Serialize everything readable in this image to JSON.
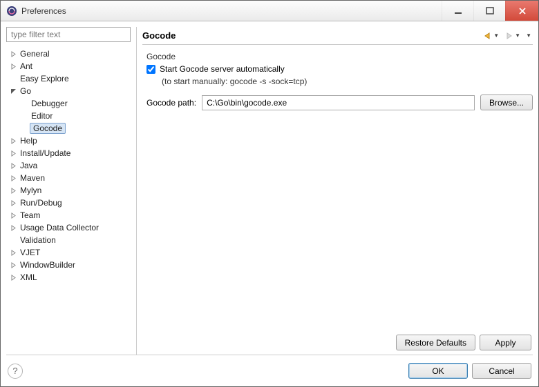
{
  "window": {
    "title": "Preferences"
  },
  "filter": {
    "placeholder": "type filter text"
  },
  "tree": {
    "items": [
      {
        "label": "General",
        "hasTwisty": true,
        "expanded": false
      },
      {
        "label": "Ant",
        "hasTwisty": true,
        "expanded": false
      },
      {
        "label": "Easy Explore",
        "hasTwisty": false
      },
      {
        "label": "Go",
        "hasTwisty": true,
        "expanded": true,
        "children": [
          {
            "label": "Debugger"
          },
          {
            "label": "Editor"
          },
          {
            "label": "Gocode",
            "selected": true
          }
        ]
      },
      {
        "label": "Help",
        "hasTwisty": true,
        "expanded": false
      },
      {
        "label": "Install/Update",
        "hasTwisty": true,
        "expanded": false
      },
      {
        "label": "Java",
        "hasTwisty": true,
        "expanded": false
      },
      {
        "label": "Maven",
        "hasTwisty": true,
        "expanded": false
      },
      {
        "label": "Mylyn",
        "hasTwisty": true,
        "expanded": false
      },
      {
        "label": "Run/Debug",
        "hasTwisty": true,
        "expanded": false
      },
      {
        "label": "Team",
        "hasTwisty": true,
        "expanded": false
      },
      {
        "label": "Usage Data Collector",
        "hasTwisty": true,
        "expanded": false
      },
      {
        "label": "Validation",
        "hasTwisty": false
      },
      {
        "label": "VJET",
        "hasTwisty": true,
        "expanded": false
      },
      {
        "label": "WindowBuilder",
        "hasTwisty": true,
        "expanded": false
      },
      {
        "label": "XML",
        "hasTwisty": true,
        "expanded": false
      }
    ]
  },
  "page": {
    "title": "Gocode",
    "group_label": "Gocode",
    "checkbox_label": "Start Gocode server automatically",
    "checkbox_checked": true,
    "hint": "(to start manually: gocode -s -sock=tcp)",
    "path_label": "Gocode path:",
    "path_value": "C:\\Go\\bin\\gocode.exe",
    "browse_label": "Browse...",
    "restore_label": "Restore Defaults",
    "apply_label": "Apply"
  },
  "footer": {
    "ok_label": "OK",
    "cancel_label": "Cancel"
  }
}
